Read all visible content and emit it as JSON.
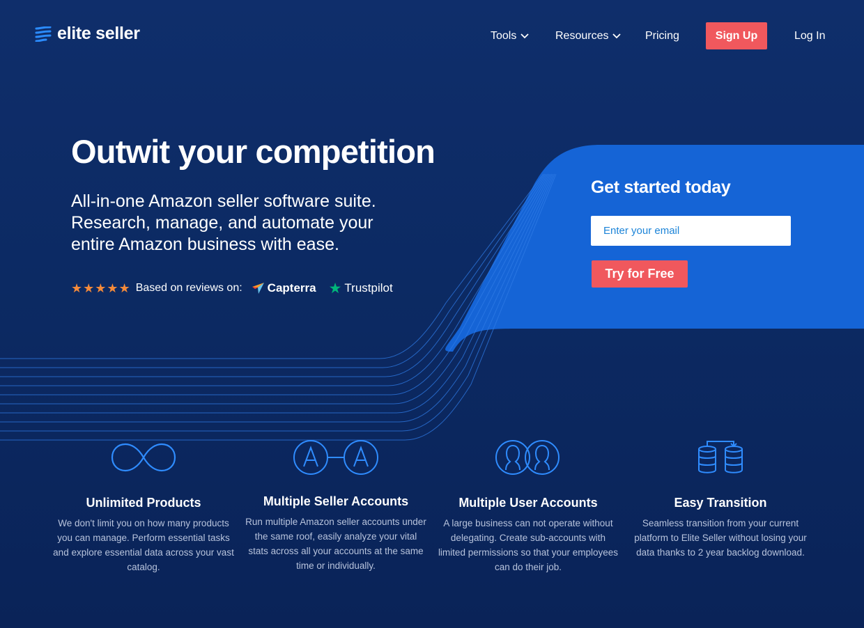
{
  "brand": {
    "name": "elite seller"
  },
  "nav": {
    "tools": "Tools",
    "resources": "Resources",
    "pricing": "Pricing",
    "signup": "Sign Up",
    "login": "Log In"
  },
  "hero": {
    "title": "Outwit your competition",
    "subtitle": "All-in-one Amazon seller software suite. Research, manage, and automate your entire Amazon business  with ease.",
    "stars": "★★★★★",
    "reviews_label": "Based on reviews on:",
    "capterra": "Capterra",
    "trustpilot": "Trustpilot"
  },
  "signup_card": {
    "title": "Get started today",
    "email_placeholder": "Enter your email",
    "cta": "Try for Free"
  },
  "features": [
    {
      "icon": "infinity-icon",
      "title": "Unlimited Products",
      "text": "We don't limit you on how many products you can manage. Perform essential tasks and explore essential data across your vast catalog."
    },
    {
      "icon": "seller-accounts-icon",
      "title": "Multiple Seller Accounts",
      "text": "Run multiple Amazon seller accounts under the same roof, easily analyze your vital stats across all your accounts at the same time or individually."
    },
    {
      "icon": "users-icon",
      "title": "Multiple User Accounts",
      "text": "A large business can not operate without delegating. Create sub-accounts with limited permissions so that your employees can do their job."
    },
    {
      "icon": "database-transfer-icon",
      "title": "Easy Transition",
      "text": "Seamless transition from your current platform to Elite Seller without losing your data thanks  to 2 year backlog download."
    }
  ],
  "colors": {
    "accent": "#f0585d",
    "card_blue": "#1565d8",
    "bg": "#0c2a63",
    "stars": "#f48a3a"
  }
}
